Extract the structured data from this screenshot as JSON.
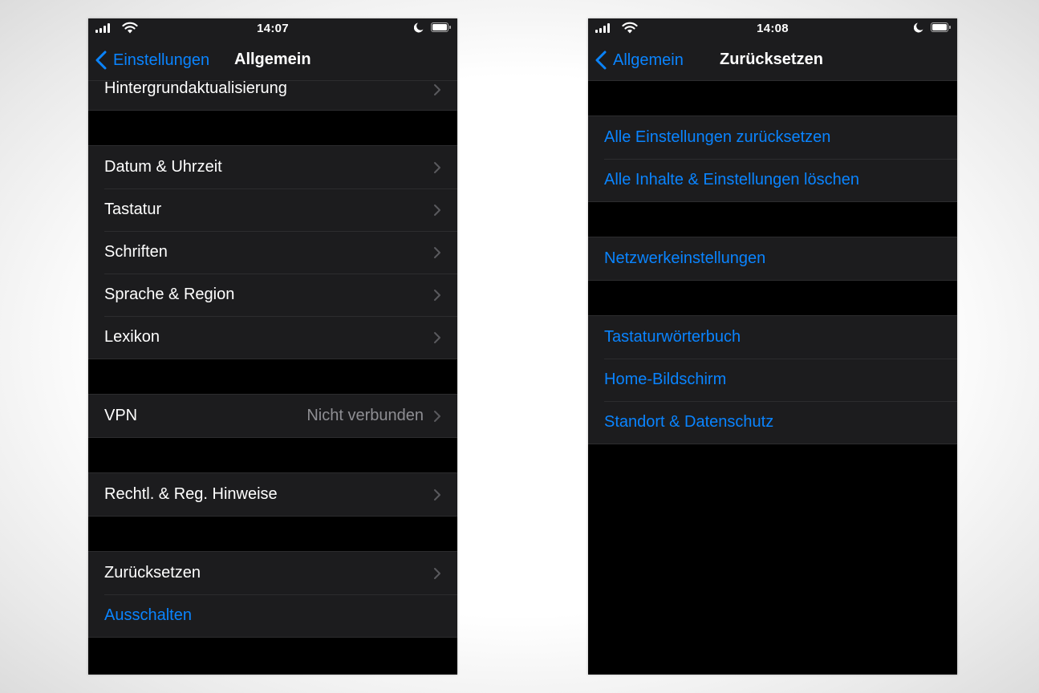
{
  "left_screen": {
    "status_bar": {
      "time": "14:07"
    },
    "nav": {
      "back_label": "Einstellungen",
      "title": "Allgemein"
    },
    "groups": [
      {
        "rows": [
          {
            "label": "Hintergrundaktualisierung",
            "chevron": true
          }
        ]
      },
      {
        "rows": [
          {
            "label": "Datum & Uhrzeit",
            "chevron": true
          },
          {
            "label": "Tastatur",
            "chevron": true
          },
          {
            "label": "Schriften",
            "chevron": true
          },
          {
            "label": "Sprache & Region",
            "chevron": true
          },
          {
            "label": "Lexikon",
            "chevron": true
          }
        ]
      },
      {
        "rows": [
          {
            "label": "VPN",
            "value": "Nicht verbunden",
            "chevron": true
          }
        ]
      },
      {
        "rows": [
          {
            "label": "Rechtl. & Reg. Hinweise",
            "chevron": true
          }
        ]
      },
      {
        "rows": [
          {
            "label": "Zurücksetzen",
            "chevron": true
          },
          {
            "label": "Ausschalten",
            "chevron": false
          }
        ]
      }
    ]
  },
  "right_screen": {
    "status_bar": {
      "time": "14:08"
    },
    "nav": {
      "back_label": "Allgemein",
      "title": "Zurücksetzen"
    },
    "groups": [
      {
        "rows": [
          {
            "label": "Alle Einstellungen zurücksetzen"
          },
          {
            "label": "Alle Inhalte & Einstellungen löschen"
          }
        ]
      },
      {
        "rows": [
          {
            "label": "Netzwerkeinstellungen"
          }
        ]
      },
      {
        "rows": [
          {
            "label": "Tastaturwörterbuch"
          },
          {
            "label": "Home-Bildschirm"
          },
          {
            "label": "Standort & Datenschutz"
          }
        ]
      }
    ]
  },
  "colors": {
    "accent": "#0a84ff",
    "cell_background": "#1c1c1e",
    "background": "#000000",
    "secondary_text": "#8e8e93"
  },
  "icons": [
    "signal-icon",
    "wifi-icon",
    "moon-icon",
    "battery-icon",
    "back-chevron-icon",
    "chevron-right-icon"
  ]
}
